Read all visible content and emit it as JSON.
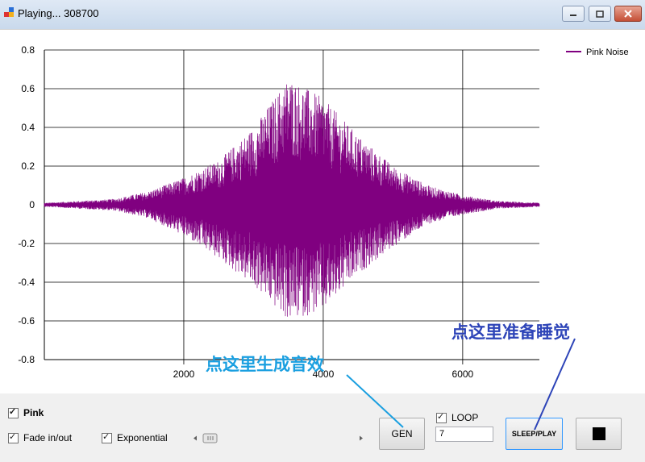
{
  "window": {
    "title": "Playing...  308700",
    "controls": {
      "minimize": "minimize-icon",
      "maximize": "maximize-icon",
      "close": "close-icon"
    }
  },
  "chart_data": {
    "type": "line",
    "title": "",
    "xlabel": "",
    "ylabel": "",
    "xlim": [
      0,
      7100
    ],
    "ylim": [
      -0.8,
      0.8
    ],
    "x_ticks": [
      "2000",
      "4000",
      "6000"
    ],
    "y_ticks": [
      "0.8",
      "0.6",
      "0.4",
      "0.2",
      "0",
      "-0.2",
      "-0.4",
      "-0.6",
      "-0.8"
    ],
    "grid": true,
    "legend_position": "top-right",
    "series": [
      {
        "name": "Pink Noise",
        "color": "#800080",
        "envelope": {
          "x": [
            0,
            1000,
            1500,
            2000,
            2500,
            3000,
            3500,
            4000,
            4500,
            5000,
            5500,
            6000,
            6500,
            7100
          ],
          "max": [
            0.01,
            0.03,
            0.07,
            0.14,
            0.23,
            0.4,
            0.66,
            0.55,
            0.36,
            0.2,
            0.1,
            0.05,
            0.02,
            0.01
          ],
          "min": [
            -0.01,
            -0.03,
            -0.07,
            -0.16,
            -0.28,
            -0.42,
            -0.6,
            -0.55,
            -0.36,
            -0.22,
            -0.1,
            -0.05,
            -0.02,
            -0.01
          ]
        }
      }
    ]
  },
  "controls": {
    "pink_label": "Pink",
    "pink_checked": true,
    "fade_label": "Fade in/out",
    "fade_checked": true,
    "exponential_label": "Exponential",
    "exponential_checked": true,
    "loop_label": "LOOP",
    "loop_checked": true,
    "loop_value": "7",
    "gen_label": "GEN",
    "sleep_play_label": "SLEEP/PLAY",
    "stop_icon": "stop-icon"
  },
  "annotations": {
    "gen_hint": "点这里生成音效",
    "gen_hint_color": "#1a9fe0",
    "sleep_hint": "点这里准备睡觉",
    "sleep_hint_color": "#2d44b8"
  }
}
